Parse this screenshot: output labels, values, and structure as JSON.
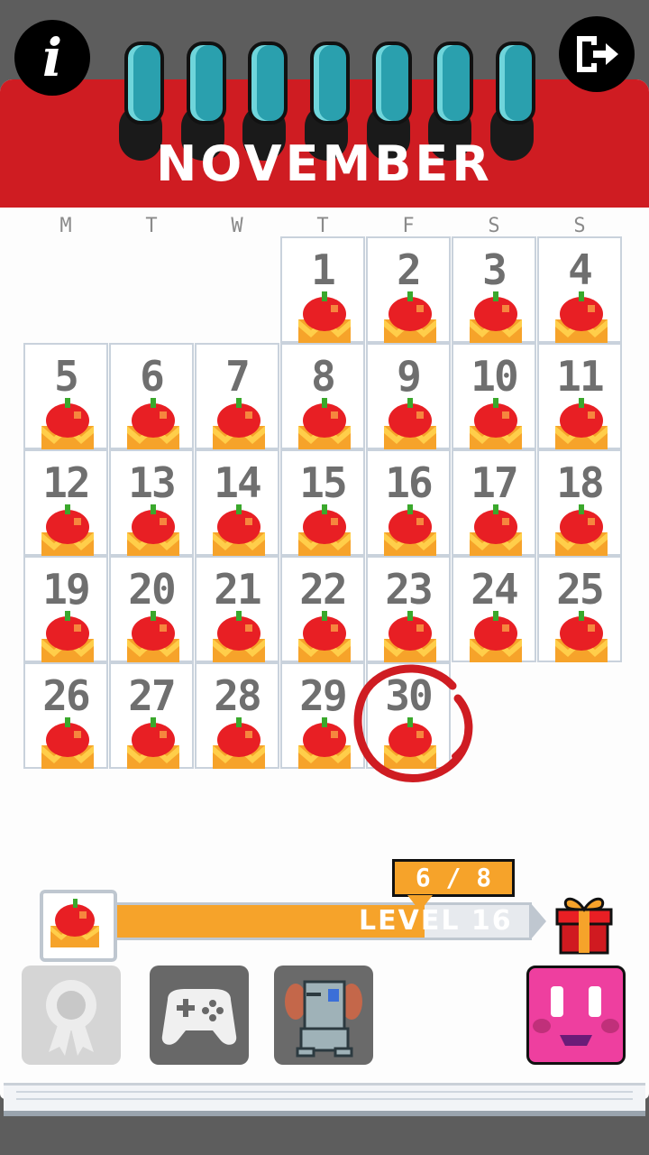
{
  "header": {
    "month": "NOVEMBER",
    "info_label": "i"
  },
  "weekdays": [
    "M",
    "T",
    "W",
    "T",
    "F",
    "S",
    "S"
  ],
  "days": [
    {
      "n": "1",
      "col": 3,
      "row": 0
    },
    {
      "n": "2",
      "col": 4,
      "row": 0
    },
    {
      "n": "3",
      "col": 5,
      "row": 0
    },
    {
      "n": "4",
      "col": 6,
      "row": 0
    },
    {
      "n": "5",
      "col": 0,
      "row": 1
    },
    {
      "n": "6",
      "col": 1,
      "row": 1
    },
    {
      "n": "7",
      "col": 2,
      "row": 1
    },
    {
      "n": "8",
      "col": 3,
      "row": 1
    },
    {
      "n": "9",
      "col": 4,
      "row": 1
    },
    {
      "n": "10",
      "col": 5,
      "row": 1
    },
    {
      "n": "11",
      "col": 6,
      "row": 1
    },
    {
      "n": "12",
      "col": 0,
      "row": 2
    },
    {
      "n": "13",
      "col": 1,
      "row": 2
    },
    {
      "n": "14",
      "col": 2,
      "row": 2
    },
    {
      "n": "15",
      "col": 3,
      "row": 2
    },
    {
      "n": "16",
      "col": 4,
      "row": 2
    },
    {
      "n": "17",
      "col": 5,
      "row": 2
    },
    {
      "n": "18",
      "col": 6,
      "row": 2
    },
    {
      "n": "19",
      "col": 0,
      "row": 3
    },
    {
      "n": "20",
      "col": 1,
      "row": 3
    },
    {
      "n": "21",
      "col": 2,
      "row": 3
    },
    {
      "n": "22",
      "col": 3,
      "row": 3
    },
    {
      "n": "23",
      "col": 4,
      "row": 3
    },
    {
      "n": "24",
      "col": 5,
      "row": 3
    },
    {
      "n": "25",
      "col": 6,
      "row": 3
    },
    {
      "n": "26",
      "col": 0,
      "row": 4
    },
    {
      "n": "27",
      "col": 1,
      "row": 4
    },
    {
      "n": "28",
      "col": 2,
      "row": 4
    },
    {
      "n": "29",
      "col": 3,
      "row": 4
    },
    {
      "n": "30",
      "col": 4,
      "row": 4
    }
  ],
  "today": "30",
  "progress": {
    "count_text": "6 / 8",
    "level_text": "LEVEL 16",
    "fraction": 0.75
  },
  "bottom_buttons": [
    "award-ribbon-icon",
    "gamepad-icon",
    "pet-monster-icon",
    "pink-face-icon"
  ],
  "colors": {
    "header_red": "#cf1c22",
    "ring_teal": "#2aa0ae",
    "progress_orange": "#f6a32a",
    "face_pink": "#ee3f9f",
    "number_gray": "#6f6f6f"
  }
}
